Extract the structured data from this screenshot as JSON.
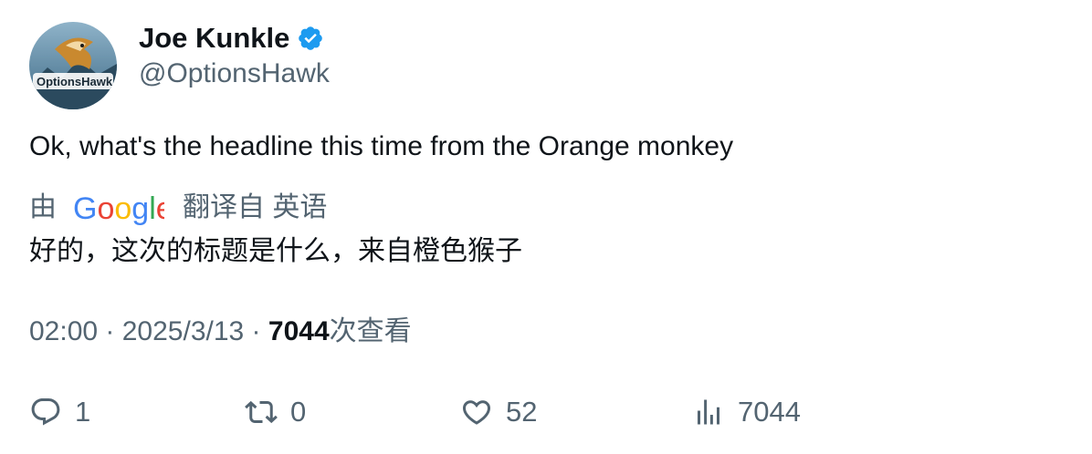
{
  "author": {
    "display_name": "Joe Kunkle",
    "handle": "@OptionsHawk",
    "verified": true,
    "avatar_text": "OptionsHawk",
    "avatar_icon": "hawk-logo-avatar"
  },
  "tweet": {
    "text": "Ok, what's the headline this time from the Orange monkey"
  },
  "translation": {
    "prefix": "由",
    "provider_logo": "Google",
    "suffix": "翻译自 英语",
    "text": "好的，这次的标题是什么，来自橙色猴子"
  },
  "meta": {
    "time": "02:00",
    "separator": " · ",
    "date": "2025/3/13",
    "views_count": "7044",
    "views_label": "次查看"
  },
  "actions": {
    "replies": "1",
    "retweets": "0",
    "likes": "52",
    "views": "7044"
  },
  "colors": {
    "verified": "#1d9bf0",
    "secondary_text": "#536471",
    "primary_text": "#0f1419"
  }
}
